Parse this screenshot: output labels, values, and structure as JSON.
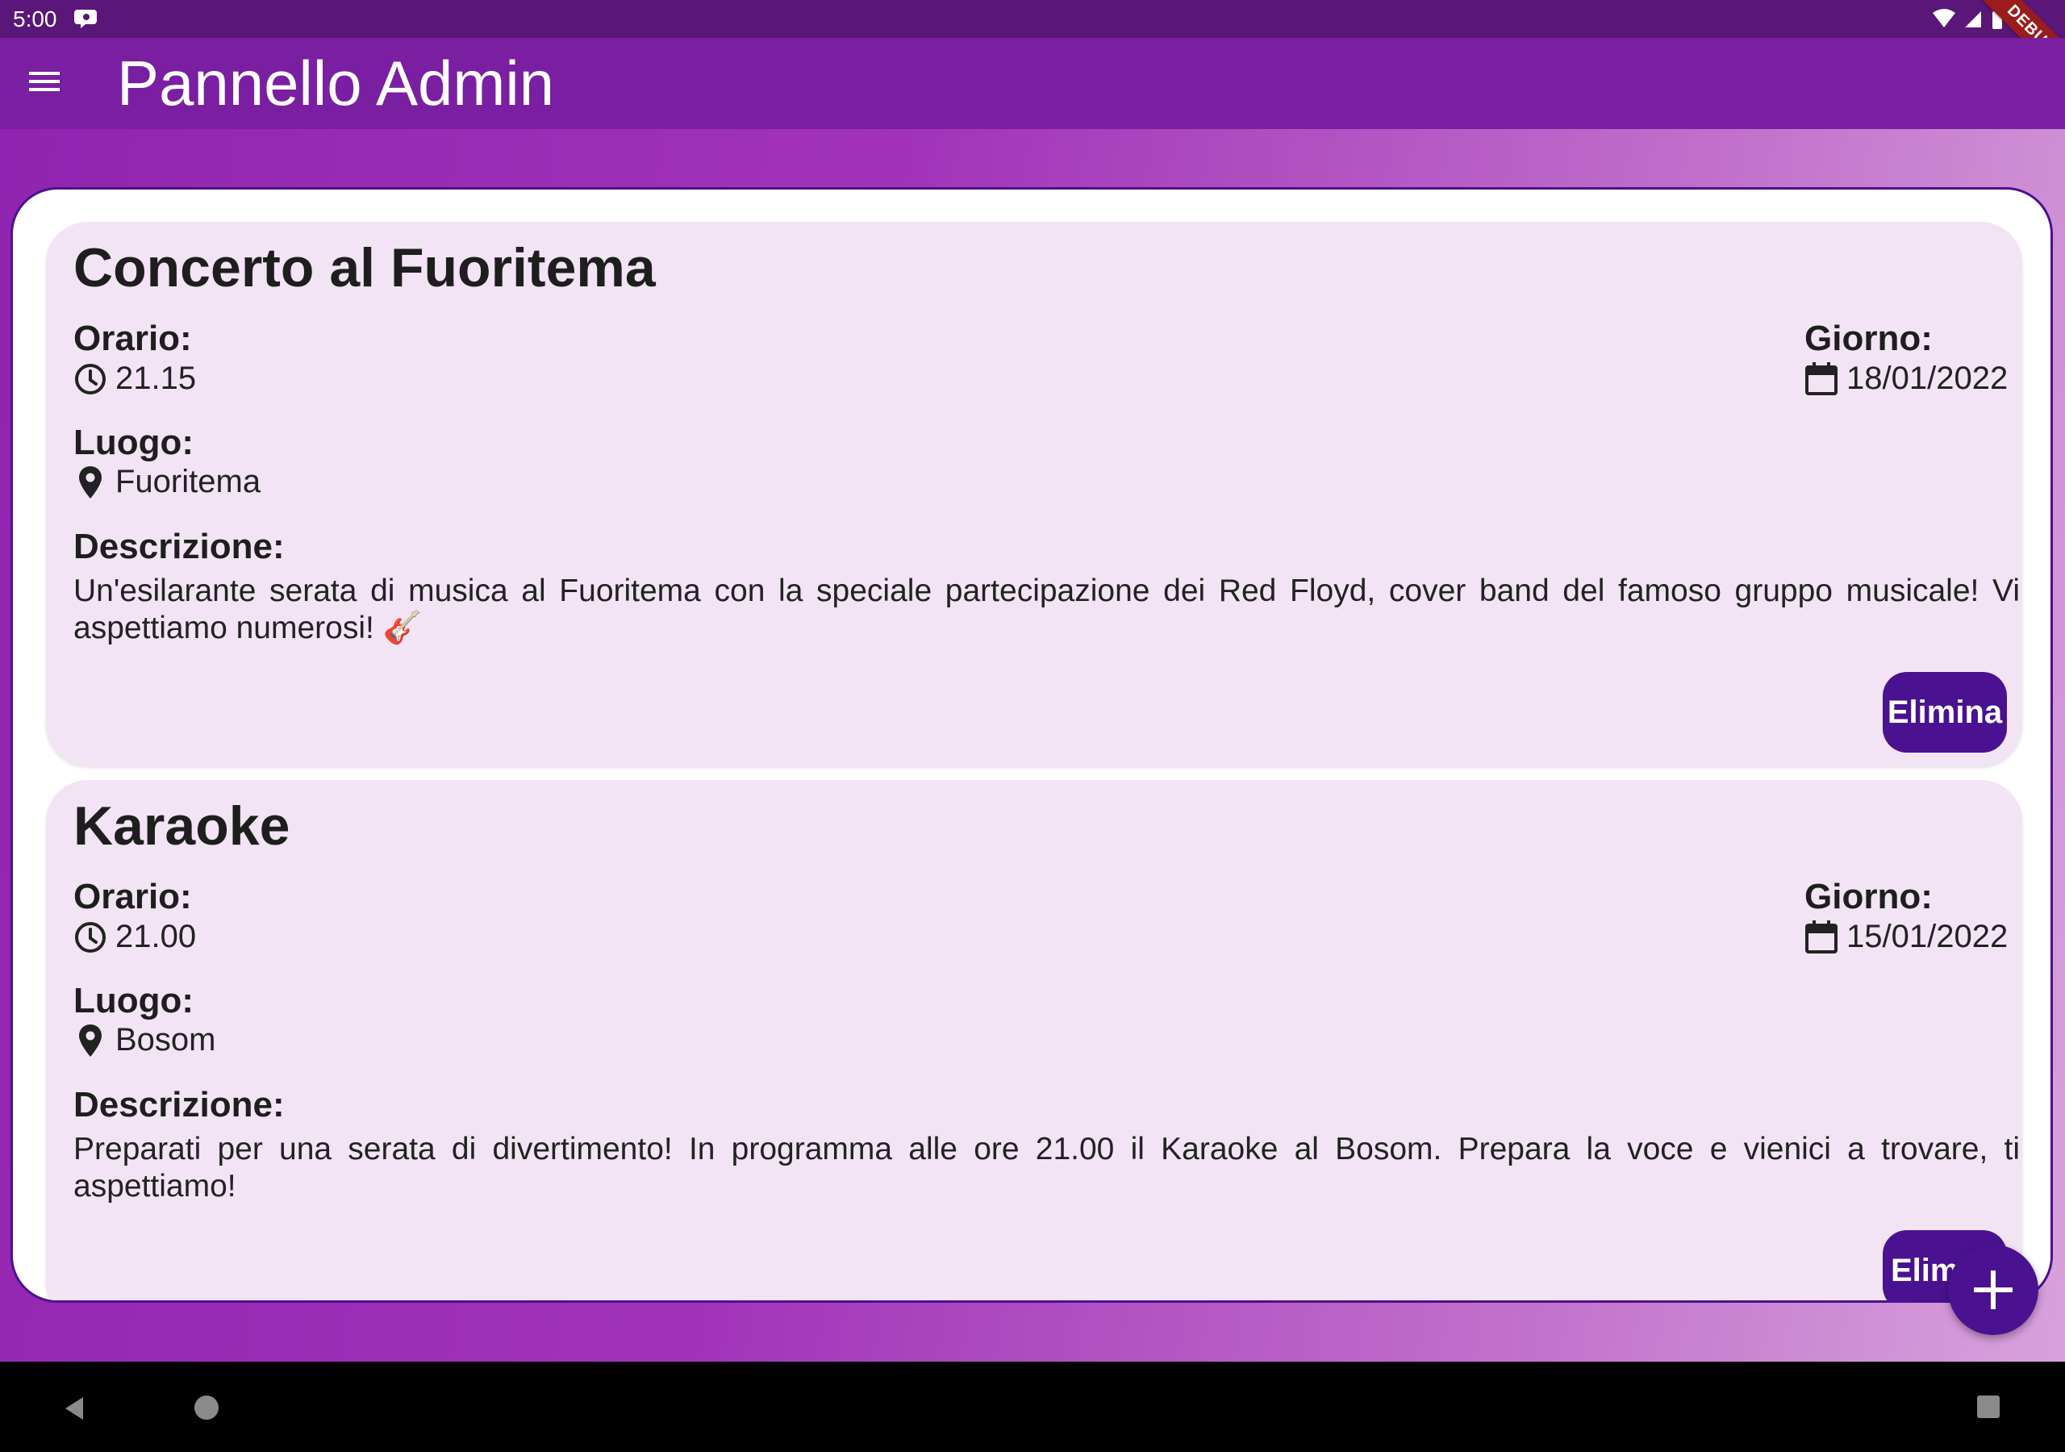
{
  "status_bar": {
    "time": "5:00"
  },
  "debug_banner": "DEBUG",
  "app_bar": {
    "title": "Pannello Admin"
  },
  "events": [
    {
      "title": "Concerto al Fuoritema",
      "time_label": "Orario:",
      "time": "21.15",
      "day_label": "Giorno:",
      "day": "18/01/2022",
      "place_label": "Luogo:",
      "place": "Fuoritema",
      "description_label": "Descrizione:",
      "description": "Un'esilarante serata di musica al Fuoritema con la speciale partecipazione dei Red Floyd, cover band del famoso gruppo musicale! Vi aspettiamo numerosi! 🎸",
      "delete_label": "Elimina"
    },
    {
      "title": "Karaoke",
      "time_label": "Orario:",
      "time": "21.00",
      "day_label": "Giorno:",
      "day": "15/01/2022",
      "place_label": "Luogo:",
      "place": "Bosom",
      "description_label": "Descrizione:",
      "description": "Preparati per una serata di divertimento! In programma alle ore 21.00 il Karaoke al Bosom. Prepara la voce e vienici a trovare, ti aspettiamo!",
      "delete_label": "Elim"
    }
  ],
  "icons": {
    "menu": "menu-icon",
    "time": "clock-icon",
    "day": "calendar-icon",
    "place": "location-pin-icon",
    "fab": "plus-icon"
  },
  "colors": {
    "status_bar": "#5a1678",
    "app_bar": "#7a1fa2",
    "accent": "#4a1290",
    "card_bg": "#f2e4f4"
  }
}
